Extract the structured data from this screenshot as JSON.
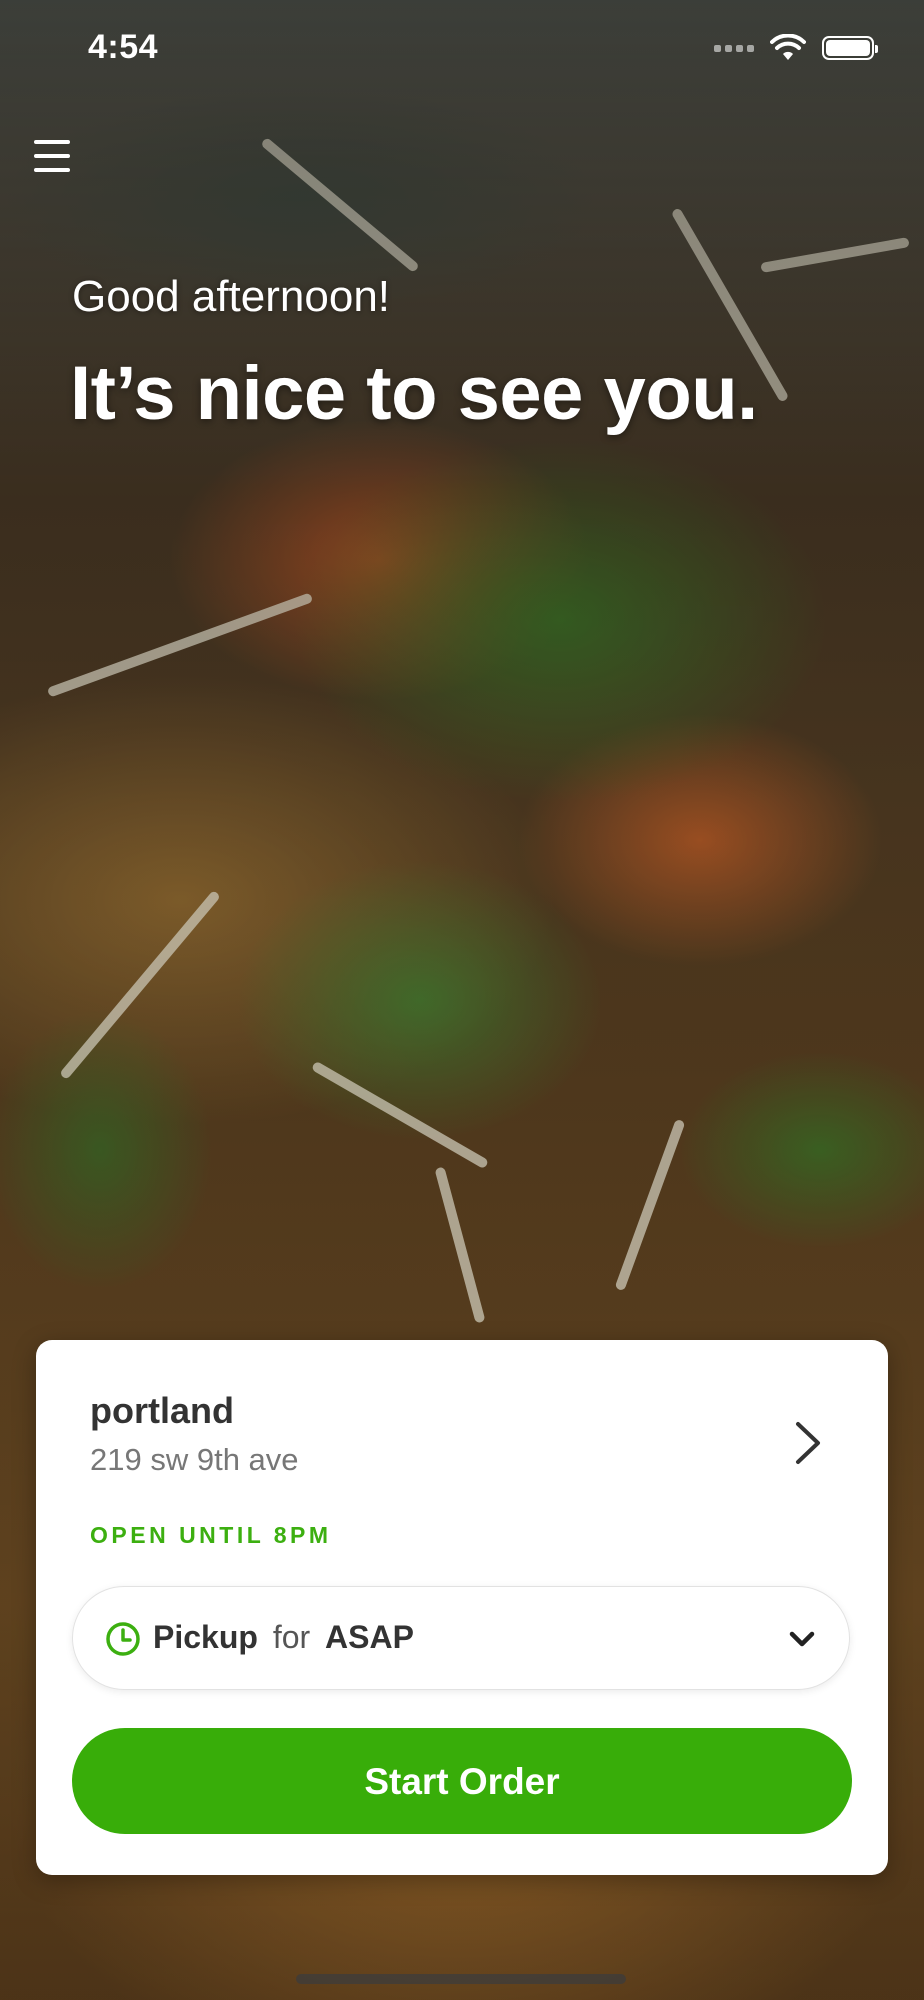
{
  "status_bar": {
    "time": "4:54",
    "icons": [
      "cellular-signal-icon",
      "wifi-icon",
      "battery-icon"
    ]
  },
  "nav": {
    "menu_icon": "hamburger-menu-icon"
  },
  "hero": {
    "greeting": "Good afternoon!",
    "headline": "It’s nice to see you."
  },
  "location": {
    "name": "portland",
    "address": "219 sw 9th ave",
    "status": "OPEN UNTIL 8PM",
    "status_color": "#3caf10"
  },
  "order_type": {
    "mode": "Pickup",
    "connector": "for",
    "time": "ASAP",
    "icon": "clock-icon"
  },
  "actions": {
    "start_order": "Start Order",
    "button_color": "#38ad09"
  }
}
